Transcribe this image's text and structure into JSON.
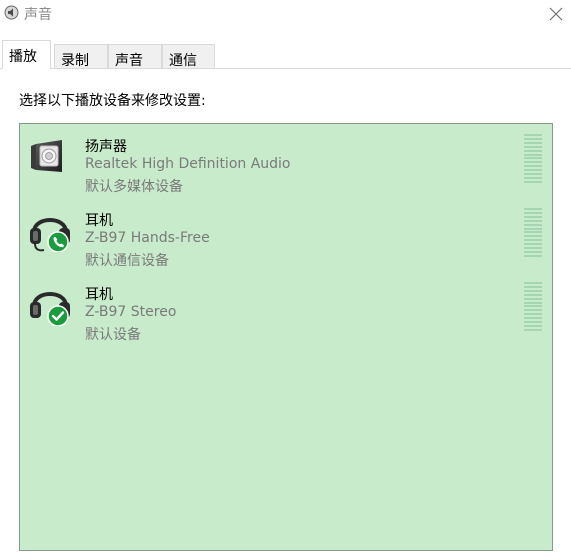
{
  "window": {
    "title": "声音",
    "close_label": "✕"
  },
  "tabs": [
    {
      "label": "播放",
      "active": true
    },
    {
      "label": "录制",
      "active": false
    },
    {
      "label": "声音",
      "active": false
    },
    {
      "label": "通信",
      "active": false
    }
  ],
  "panel": {
    "instruction": "选择以下播放设备来修改设置:"
  },
  "devices": [
    {
      "name": "扬声器",
      "description": "Realtek High Definition Audio",
      "status": "默认多媒体设备",
      "icon": "speaker-icon",
      "badge": ""
    },
    {
      "name": "耳机",
      "description": "Z-B97 Hands-Free",
      "status": "默认通信设备",
      "icon": "headset-icon",
      "badge": "phone-badge-icon"
    },
    {
      "name": "耳机",
      "description": "Z-B97 Stereo",
      "status": "默认设备",
      "icon": "headset-icon",
      "badge": "check-badge-icon"
    }
  ],
  "colors": {
    "list_background": "#c8ebcb",
    "meter_bar": "#a6d5b4",
    "badge_green": "#1a9b3c"
  }
}
